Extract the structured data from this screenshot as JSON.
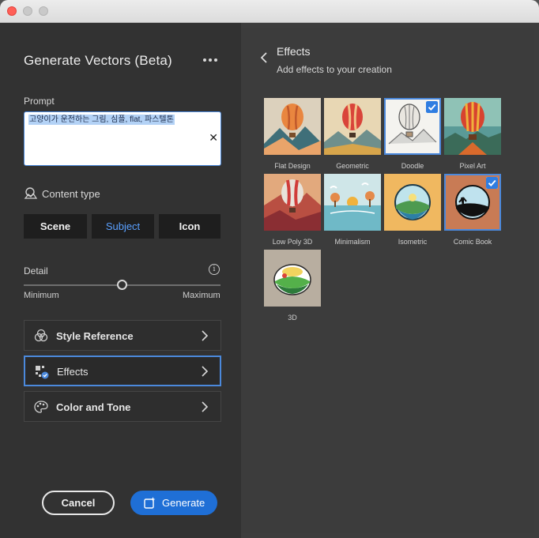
{
  "panel": {
    "title": "Generate Vectors (Beta)",
    "prompt_label": "Prompt",
    "prompt_value": "고양이가 운전하는 그림, 심플, flat, 파스텔톤",
    "content_type_label": "Content type",
    "content_types": [
      "Scene",
      "Subject",
      "Icon"
    ],
    "selected_content_type": "Subject",
    "detail_label": "Detail",
    "detail_min": "Minimum",
    "detail_max": "Maximum",
    "detail_level": 0.5,
    "sections": [
      {
        "label": "Style Reference",
        "icon": "style-reference-icon"
      },
      {
        "label": "Effects",
        "icon": "effects-icon"
      },
      {
        "label": "Color and Tone",
        "icon": "palette-icon"
      }
    ],
    "active_section": "Effects",
    "cancel_label": "Cancel",
    "generate_label": "Generate"
  },
  "effects": {
    "title": "Effects",
    "subtitle": "Add effects to your creation",
    "items": [
      {
        "label": "Flat Design",
        "selected": false
      },
      {
        "label": "Geometric",
        "selected": false
      },
      {
        "label": "Doodle",
        "selected": true
      },
      {
        "label": "Pixel Art",
        "selected": false
      },
      {
        "label": "Low Poly 3D",
        "selected": false
      },
      {
        "label": "Minimalism",
        "selected": false
      },
      {
        "label": "Isometric",
        "selected": false
      },
      {
        "label": "Comic Book",
        "selected": true
      },
      {
        "label": "3D",
        "selected": false
      }
    ]
  },
  "colors": {
    "accent": "#1f6fd6",
    "selection": "#4b89dc",
    "close": "#ff5f57"
  }
}
